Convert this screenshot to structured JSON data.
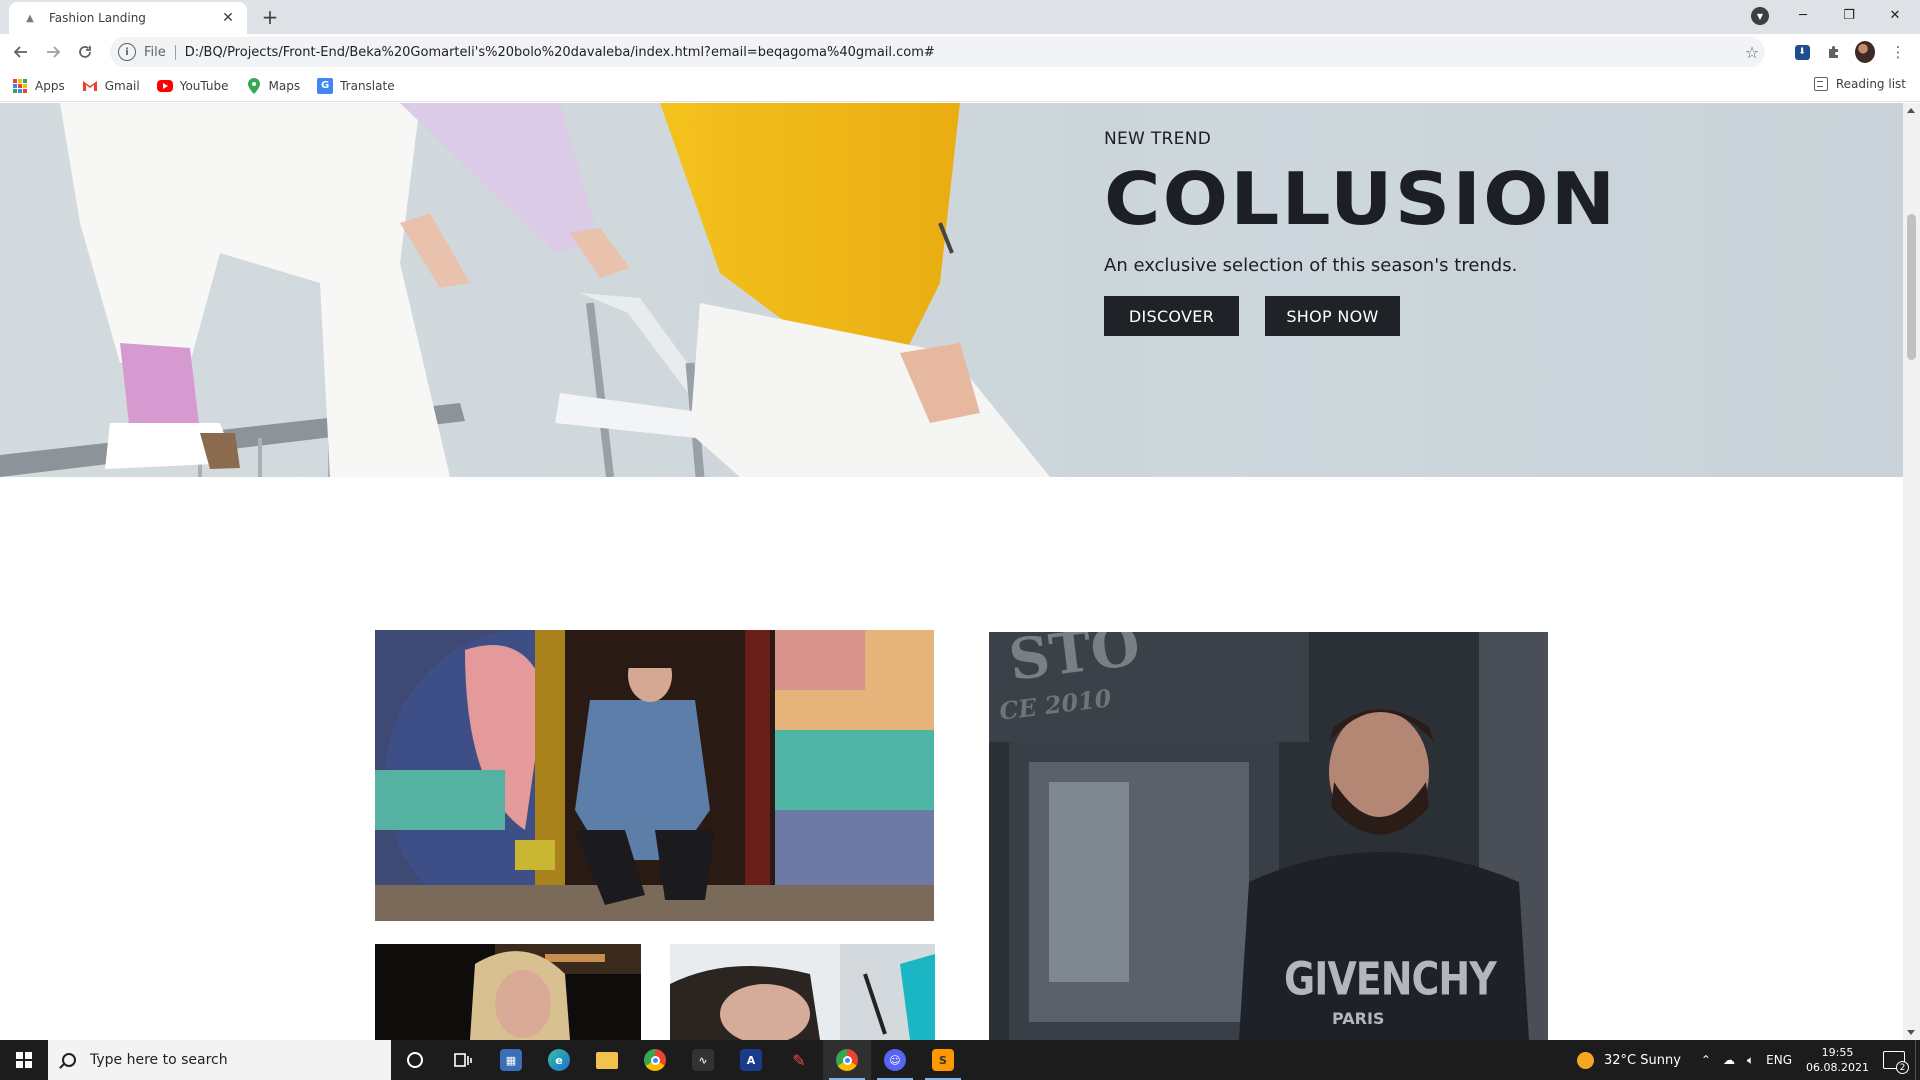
{
  "browser": {
    "tab": {
      "title": "Fashion Landing",
      "close": "✕"
    },
    "new_tab": "+",
    "window_controls": {
      "minimize": "─",
      "restore": "❐",
      "close": "✕"
    },
    "address": {
      "scheme": "File",
      "url": "D:/BQ/Projects/Front-End/Beka%20Gomarteli's%20bolo%20davaleba/index.html?email=beqagoma%40gmail.com#"
    },
    "bookmarks": [
      {
        "label": "Apps",
        "icon": "apps-grid-icon"
      },
      {
        "label": "Gmail",
        "icon": "gmail-icon"
      },
      {
        "label": "YouTube",
        "icon": "youtube-icon"
      },
      {
        "label": "Maps",
        "icon": "maps-icon"
      },
      {
        "label": "Translate",
        "icon": "translate-icon"
      }
    ],
    "reading_list": "Reading list"
  },
  "hero": {
    "kicker": "NEW TREND",
    "title": "COLLUSION",
    "subtitle": "An exclusive selection of this season's trends.",
    "buttons": {
      "discover": "DISCOVER",
      "shop": "SHOP NOW"
    }
  },
  "gallery": {
    "shirt_brand": "GIVENCHY",
    "shirt_city": "PARIS",
    "store_sign": "STO",
    "store_since": "CE 2010"
  },
  "taskbar": {
    "search_placeholder": "Type here to search",
    "weather": "32°C  Sunny",
    "language": "ENG",
    "time": "19:55",
    "date": "06.08.2021",
    "notifications": "2"
  },
  "colors": {
    "accent_dark": "#1f2227",
    "hero_bg": "#cfd8dd",
    "chrome_tabstrip": "#dee1e6",
    "taskbar": "#1c1c1c"
  }
}
